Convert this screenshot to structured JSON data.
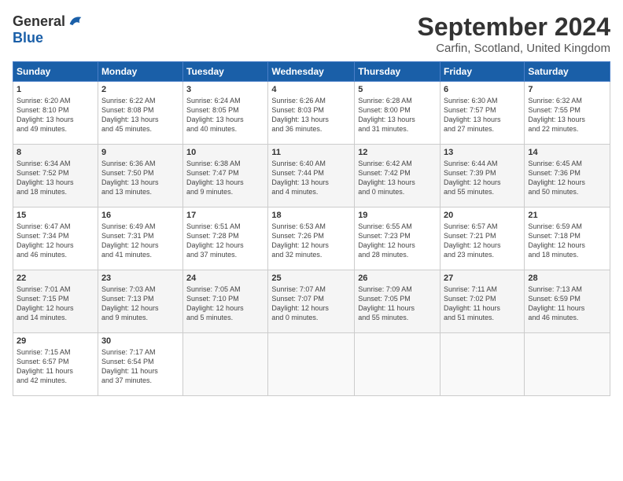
{
  "header": {
    "logo_general": "General",
    "logo_blue": "Blue",
    "title": "September 2024",
    "subtitle": "Carfin, Scotland, United Kingdom"
  },
  "calendar": {
    "days": [
      "Sunday",
      "Monday",
      "Tuesday",
      "Wednesday",
      "Thursday",
      "Friday",
      "Saturday"
    ],
    "weeks": [
      [
        {
          "day": "1",
          "content": "Sunrise: 6:20 AM\nSunset: 8:10 PM\nDaylight: 13 hours\nand 49 minutes."
        },
        {
          "day": "2",
          "content": "Sunrise: 6:22 AM\nSunset: 8:08 PM\nDaylight: 13 hours\nand 45 minutes."
        },
        {
          "day": "3",
          "content": "Sunrise: 6:24 AM\nSunset: 8:05 PM\nDaylight: 13 hours\nand 40 minutes."
        },
        {
          "day": "4",
          "content": "Sunrise: 6:26 AM\nSunset: 8:03 PM\nDaylight: 13 hours\nand 36 minutes."
        },
        {
          "day": "5",
          "content": "Sunrise: 6:28 AM\nSunset: 8:00 PM\nDaylight: 13 hours\nand 31 minutes."
        },
        {
          "day": "6",
          "content": "Sunrise: 6:30 AM\nSunset: 7:57 PM\nDaylight: 13 hours\nand 27 minutes."
        },
        {
          "day": "7",
          "content": "Sunrise: 6:32 AM\nSunset: 7:55 PM\nDaylight: 13 hours\nand 22 minutes."
        }
      ],
      [
        {
          "day": "8",
          "content": "Sunrise: 6:34 AM\nSunset: 7:52 PM\nDaylight: 13 hours\nand 18 minutes."
        },
        {
          "day": "9",
          "content": "Sunrise: 6:36 AM\nSunset: 7:50 PM\nDaylight: 13 hours\nand 13 minutes."
        },
        {
          "day": "10",
          "content": "Sunrise: 6:38 AM\nSunset: 7:47 PM\nDaylight: 13 hours\nand 9 minutes."
        },
        {
          "day": "11",
          "content": "Sunrise: 6:40 AM\nSunset: 7:44 PM\nDaylight: 13 hours\nand 4 minutes."
        },
        {
          "day": "12",
          "content": "Sunrise: 6:42 AM\nSunset: 7:42 PM\nDaylight: 13 hours\nand 0 minutes."
        },
        {
          "day": "13",
          "content": "Sunrise: 6:44 AM\nSunset: 7:39 PM\nDaylight: 12 hours\nand 55 minutes."
        },
        {
          "day": "14",
          "content": "Sunrise: 6:45 AM\nSunset: 7:36 PM\nDaylight: 12 hours\nand 50 minutes."
        }
      ],
      [
        {
          "day": "15",
          "content": "Sunrise: 6:47 AM\nSunset: 7:34 PM\nDaylight: 12 hours\nand 46 minutes."
        },
        {
          "day": "16",
          "content": "Sunrise: 6:49 AM\nSunset: 7:31 PM\nDaylight: 12 hours\nand 41 minutes."
        },
        {
          "day": "17",
          "content": "Sunrise: 6:51 AM\nSunset: 7:28 PM\nDaylight: 12 hours\nand 37 minutes."
        },
        {
          "day": "18",
          "content": "Sunrise: 6:53 AM\nSunset: 7:26 PM\nDaylight: 12 hours\nand 32 minutes."
        },
        {
          "day": "19",
          "content": "Sunrise: 6:55 AM\nSunset: 7:23 PM\nDaylight: 12 hours\nand 28 minutes."
        },
        {
          "day": "20",
          "content": "Sunrise: 6:57 AM\nSunset: 7:21 PM\nDaylight: 12 hours\nand 23 minutes."
        },
        {
          "day": "21",
          "content": "Sunrise: 6:59 AM\nSunset: 7:18 PM\nDaylight: 12 hours\nand 18 minutes."
        }
      ],
      [
        {
          "day": "22",
          "content": "Sunrise: 7:01 AM\nSunset: 7:15 PM\nDaylight: 12 hours\nand 14 minutes."
        },
        {
          "day": "23",
          "content": "Sunrise: 7:03 AM\nSunset: 7:13 PM\nDaylight: 12 hours\nand 9 minutes."
        },
        {
          "day": "24",
          "content": "Sunrise: 7:05 AM\nSunset: 7:10 PM\nDaylight: 12 hours\nand 5 minutes."
        },
        {
          "day": "25",
          "content": "Sunrise: 7:07 AM\nSunset: 7:07 PM\nDaylight: 12 hours\nand 0 minutes."
        },
        {
          "day": "26",
          "content": "Sunrise: 7:09 AM\nSunset: 7:05 PM\nDaylight: 11 hours\nand 55 minutes."
        },
        {
          "day": "27",
          "content": "Sunrise: 7:11 AM\nSunset: 7:02 PM\nDaylight: 11 hours\nand 51 minutes."
        },
        {
          "day": "28",
          "content": "Sunrise: 7:13 AM\nSunset: 6:59 PM\nDaylight: 11 hours\nand 46 minutes."
        }
      ],
      [
        {
          "day": "29",
          "content": "Sunrise: 7:15 AM\nSunset: 6:57 PM\nDaylight: 11 hours\nand 42 minutes."
        },
        {
          "day": "30",
          "content": "Sunrise: 7:17 AM\nSunset: 6:54 PM\nDaylight: 11 hours\nand 37 minutes."
        },
        {
          "day": "",
          "content": ""
        },
        {
          "day": "",
          "content": ""
        },
        {
          "day": "",
          "content": ""
        },
        {
          "day": "",
          "content": ""
        },
        {
          "day": "",
          "content": ""
        }
      ]
    ]
  }
}
